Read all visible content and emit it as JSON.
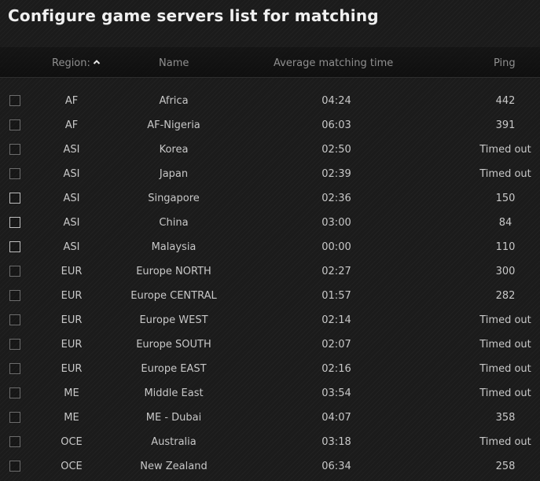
{
  "title": "Configure game servers list for matching",
  "columns": {
    "region": "Region:",
    "name": "Name",
    "avg": "Average matching time",
    "ping": "Ping"
  },
  "rows": [
    {
      "region": "AF",
      "name": "Africa",
      "avg": "04:24",
      "ping": "442"
    },
    {
      "region": "AF",
      "name": "AF-Nigeria",
      "avg": "06:03",
      "ping": "391"
    },
    {
      "region": "ASI",
      "name": "Korea",
      "avg": "02:50",
      "ping": "Timed out"
    },
    {
      "region": "ASI",
      "name": "Japan",
      "avg": "02:39",
      "ping": "Timed out"
    },
    {
      "region": "ASI",
      "name": "Singapore",
      "avg": "02:36",
      "ping": "150"
    },
    {
      "region": "ASI",
      "name": "China",
      "avg": "03:00",
      "ping": "84"
    },
    {
      "region": "ASI",
      "name": "Malaysia",
      "avg": "00:00",
      "ping": "110"
    },
    {
      "region": "EUR",
      "name": "Europe NORTH",
      "avg": "02:27",
      "ping": "300"
    },
    {
      "region": "EUR",
      "name": "Europe CENTRAL",
      "avg": "01:57",
      "ping": "282"
    },
    {
      "region": "EUR",
      "name": "Europe WEST",
      "avg": "02:14",
      "ping": "Timed out"
    },
    {
      "region": "EUR",
      "name": "Europe SOUTH",
      "avg": "02:07",
      "ping": "Timed out"
    },
    {
      "region": "EUR",
      "name": "Europe EAST",
      "avg": "02:16",
      "ping": "Timed out"
    },
    {
      "region": "ME",
      "name": "Middle East",
      "avg": "03:54",
      "ping": "Timed out"
    },
    {
      "region": "ME",
      "name": "ME - Dubai",
      "avg": "04:07",
      "ping": "358"
    },
    {
      "region": "OCE",
      "name": "Australia",
      "avg": "03:18",
      "ping": "Timed out"
    },
    {
      "region": "OCE",
      "name": "New Zealand",
      "avg": "06:34",
      "ping": "258"
    }
  ]
}
